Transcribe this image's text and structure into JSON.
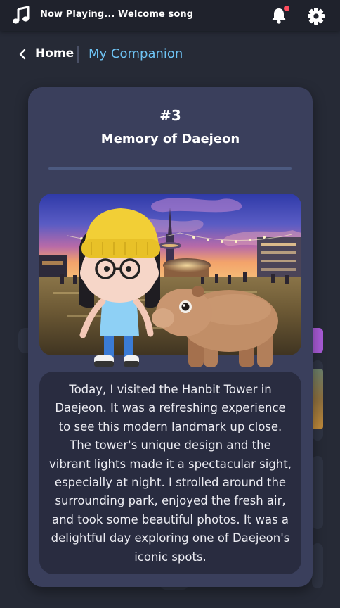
{
  "topbar": {
    "now_playing": "Now Playing... Welcome song",
    "icons": [
      "music-note-icon",
      "bell-icon",
      "gear-icon"
    ],
    "notification_dot_color": "#ff4d5e"
  },
  "breadcrumb": {
    "home": "Home",
    "current": "My Companion",
    "current_color": "#6ec3f4"
  },
  "card": {
    "number": "#3",
    "title": "Memory of Daejeon",
    "diary": "Today, I visited the Hanbit Tower in Daejeon. It was a refreshing experience to see this modern landmark up close. The tower's unique design and the vibrant lights made it a spectacular sight, especially at night. I strolled around the surrounding park, enjoyed the fresh air, and took some beautiful photos. It was a delightful day exploring one of Daejeon's iconic spots."
  },
  "colors": {
    "background": "#262a36",
    "card": "#3a3f5c",
    "text_box": "#292c40"
  }
}
